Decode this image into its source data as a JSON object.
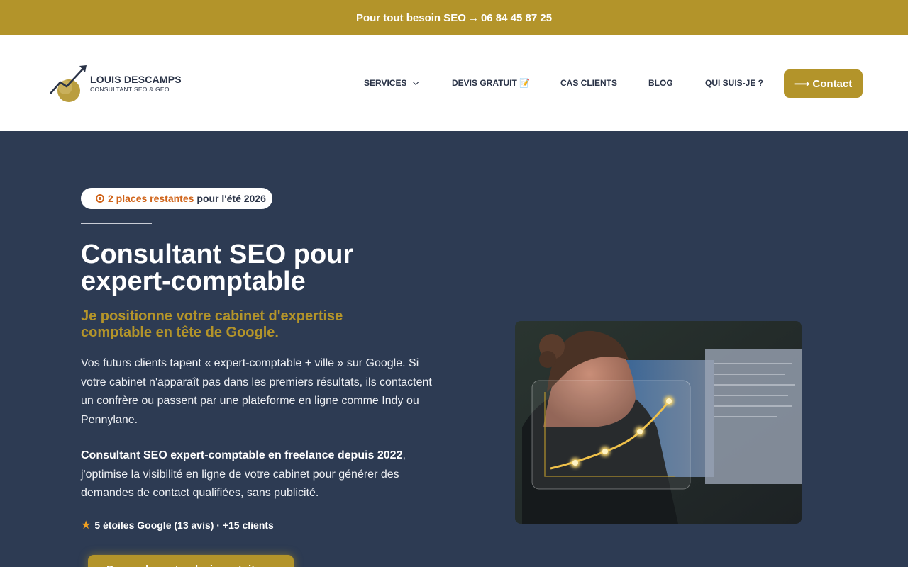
{
  "topbar": {
    "text_before": "Pour tout besoin SEO",
    "arrow": "→",
    "phone": "06 84 45 87 25"
  },
  "logo": {
    "name": "LOUIS DESCAMPS",
    "subtitle": "CONSULTANT SEO & GEO"
  },
  "nav": {
    "items": [
      {
        "label": "SERVICES"
      },
      {
        "label": "DEVIS GRATUIT 📝"
      },
      {
        "label": "CAS CLIENTS"
      },
      {
        "label": "BLOG"
      },
      {
        "label": "QUI SUIS-JE ?"
      }
    ],
    "contact_label": "⟶ Contact"
  },
  "hero": {
    "badge_highlight": "2 places restantes",
    "badge_rest": "pour l'été 2026",
    "title": "Consultant SEO pour expert-comptable",
    "subtitle": "Je positionne votre cabinet d'expertise comptable en tête de Google.",
    "paragraph1": "Vos futurs clients tapent « expert-comptable + ville » sur Google. Si votre cabinet n'apparaît pas dans les premiers résultats, ils contactent un confrère ou passent par une plateforme en ligne comme Indy ou Pennylane.",
    "paragraph2_bold": "Consultant SEO expert-comptable en freelance depuis 2022",
    "paragraph2_rest": ", j'optimise la visibilité en ligne de votre cabinet pour générer des demandes de contact qualifiées, sans publicité.",
    "rating_text": "5 étoiles Google (13 avis) · +15 clients",
    "cta_label": "Demandez votre devis gratuit"
  },
  "colors": {
    "gold": "#b3942a",
    "navy": "#2d3b53",
    "orange": "#d0641a"
  }
}
